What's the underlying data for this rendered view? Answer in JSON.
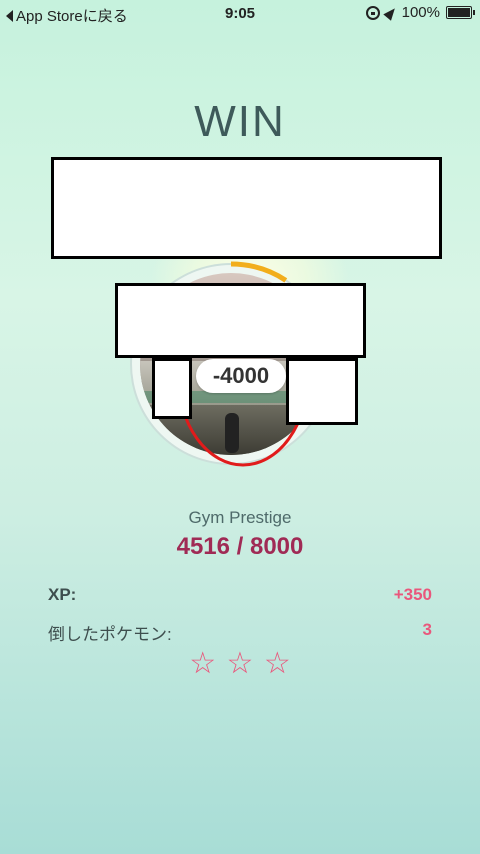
{
  "status_bar": {
    "back_label": "App Storeに戻る",
    "time": "9:05",
    "battery": "100%"
  },
  "result": {
    "title": "WIN"
  },
  "gym": {
    "prestige_change": "-4000",
    "prestige_label": "Gym Prestige",
    "prestige_value": "4516 / 8000",
    "prestige_progress": 0.56
  },
  "rewards": {
    "xp_label": "XP:",
    "xp_value": "+350",
    "defeated_label": "倒したポケモン:",
    "defeated_value": "3"
  },
  "stars": {
    "glyph": "☆",
    "count": 3
  },
  "colors": {
    "accent": "#e9577c",
    "prestige_text": "#a02a55",
    "progress_arc": "#f2ae1c",
    "annotation_red": "#e11b1b"
  }
}
